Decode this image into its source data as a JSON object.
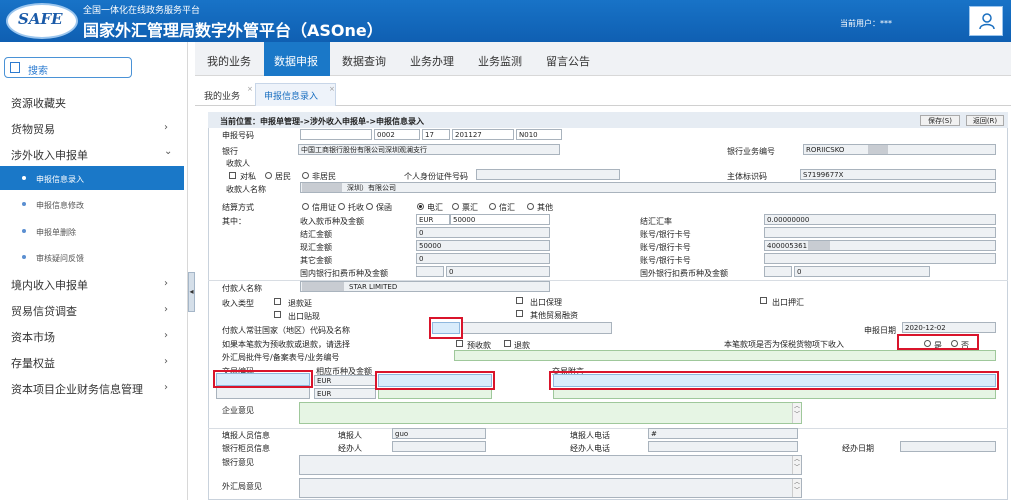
{
  "header": {
    "logo": "SAFE",
    "subtitle": "全国一体化在线政务服务平台",
    "title": "国家外汇管理局数字外管平台（ASOne）",
    "user_label": "当前用户：",
    "user_name": "***",
    "user_icon": "user-icon"
  },
  "sidebar": {
    "search_label": "搜索",
    "items": [
      {
        "label": "资源收藏夹"
      },
      {
        "label": "货物贸易",
        "arrow": "›"
      },
      {
        "label": "涉外收入申报单",
        "arrow": "⌄"
      },
      {
        "label": "境内收入申报单",
        "arrow": "›"
      },
      {
        "label": "贸易信贷调查",
        "arrow": "›"
      },
      {
        "label": "资本市场",
        "arrow": "›"
      },
      {
        "label": "存量权益",
        "arrow": "›"
      },
      {
        "label": "资本项目企业财务信息管理",
        "arrow": "›"
      }
    ],
    "subitems": [
      "申报信息录入",
      "申报信息修改",
      "申报单删除",
      "审核疑问反馈"
    ],
    "collapse": "◂"
  },
  "topnav": [
    "我的业务",
    "数据申报",
    "数据查询",
    "业务办理",
    "业务监测",
    "留言公告"
  ],
  "tabs": [
    {
      "label": "我的业务",
      "close": "×"
    },
    {
      "label": "申报信息录入",
      "close": "×"
    }
  ],
  "form": {
    "crumb": "当前位置：申报单管理->涉外收入申报单->申报信息录入",
    "save_btn": "保存(S)",
    "back_btn": "返回(R)",
    "labels": {
      "report_no": "申报号码",
      "bank": "银行",
      "bank_code": "银行业务编号",
      "payee": "收款人",
      "private": "对私",
      "resident": "居民",
      "nonresident": "非居民",
      "id_no": "个人身份证件号码",
      "entity_id": "主体标识码",
      "payee_name": "收款人名称",
      "settle_method": "结算方式",
      "of_which": "其中：",
      "currency_amount": "收入款币种及金额",
      "exchange_rate": "结汇汇率",
      "settle_amount": "结汇金额",
      "account1": "账号/银行卡号",
      "spot_amount": "现汇金额",
      "account2": "账号/银行卡号",
      "other_amount": "其它金额",
      "account3": "账号/银行卡号",
      "dom_fee": "国内银行扣费币种及金额",
      "foreign_fee": "国外银行扣费币种及金额",
      "payer_name": "付款人名称",
      "income_type": "收入类型",
      "refund": "退款延",
      "export_guarantee": "出口保理",
      "export_bill": "出口押汇",
      "export_discount": "出口贴现",
      "other_trade_finance": "其他贸易融资",
      "payer_country": "付款人常驻国家（地区）代码及名称",
      "report_date": "申报日期",
      "prepay_choose": "如果本笔款为预收款或退款，请选择",
      "prepay": "预收款",
      "refund2": "退款",
      "bonded_q": "本笔款项是否为保税货物项下收入",
      "yes": "是",
      "no": "否",
      "approval_no": "外汇局批件号/备案表号/业务编号",
      "tx_code": "交易编码",
      "tx_currency": "相应币种及金额",
      "tx_remark": "交易附言",
      "opinion": "企业意见",
      "filler_info": "填报人员信息",
      "filler": "填报人",
      "filler_tel": "填报人电话",
      "teller_info": "银行柜员信息",
      "handler": "经办人",
      "handler_tel": "经办人电话",
      "handle_date": "经办日期",
      "bank_opinion": "银行意见",
      "safe_opinion": "外汇局意见"
    },
    "settle_options": [
      "信用证",
      "托收",
      "保函",
      "电汇",
      "票汇",
      "信汇",
      "其他"
    ],
    "values": {
      "rpt1": "",
      "rpt2": "0002",
      "rpt3": "17",
      "rpt4": "201127",
      "rpt5": "N010",
      "bank": "中国工商银行股份有限公司深圳观澜支行",
      "bank_code": "RORIICSKO",
      "entity_id": "S7199677X",
      "payee_name": "深圳）有限公司",
      "cur": "EUR",
      "amount": "50000",
      "rate": "0.00000000",
      "settle_amount": "0",
      "spot_amount": "50000",
      "account2": "400005361",
      "other_amount": "0",
      "dom_fee": "0",
      "foreign_fee": "0",
      "payer_name": "STAR LIMITED",
      "report_date": "2020-12-02",
      "tx_cur1": "EUR",
      "tx_cur2": "EUR",
      "filler": "guo",
      "filler_tel": "#"
    },
    "scroll_up": "︿",
    "scroll_down": "﹀"
  }
}
